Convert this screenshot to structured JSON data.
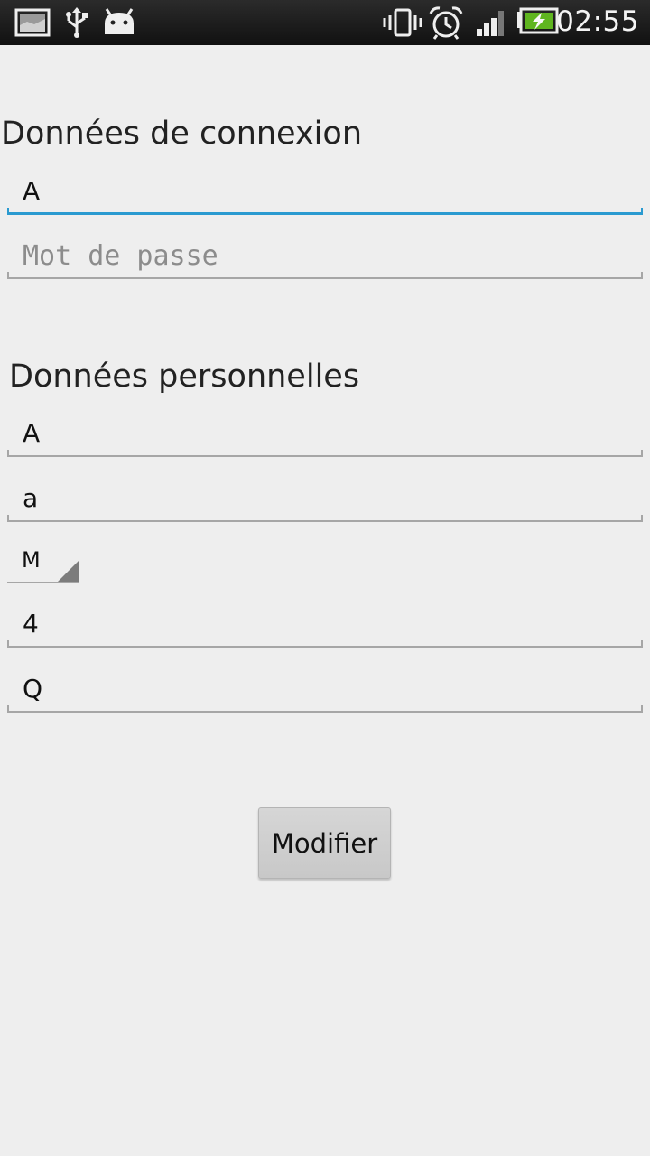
{
  "status_bar": {
    "time": "02:55",
    "icons": [
      "image-notification-icon",
      "usb-icon",
      "android-debug-icon",
      "vibrate-icon",
      "alarm-icon",
      "signal-icon",
      "battery-charging-icon"
    ]
  },
  "login_section": {
    "title": "Données de connexion",
    "username_value": "A",
    "password_placeholder": "Mot de passe"
  },
  "personal_section": {
    "title": "Données personnelles",
    "field1_value": "A",
    "field2_value": "a",
    "spinner_value": "M",
    "field3_value": "4",
    "field4_value": "Q"
  },
  "actions": {
    "modify_label": "Modifier"
  },
  "colors": {
    "background": "#eeeeee",
    "focus_accent": "#2a9ad0",
    "status_bar": "#1a1a1a"
  }
}
